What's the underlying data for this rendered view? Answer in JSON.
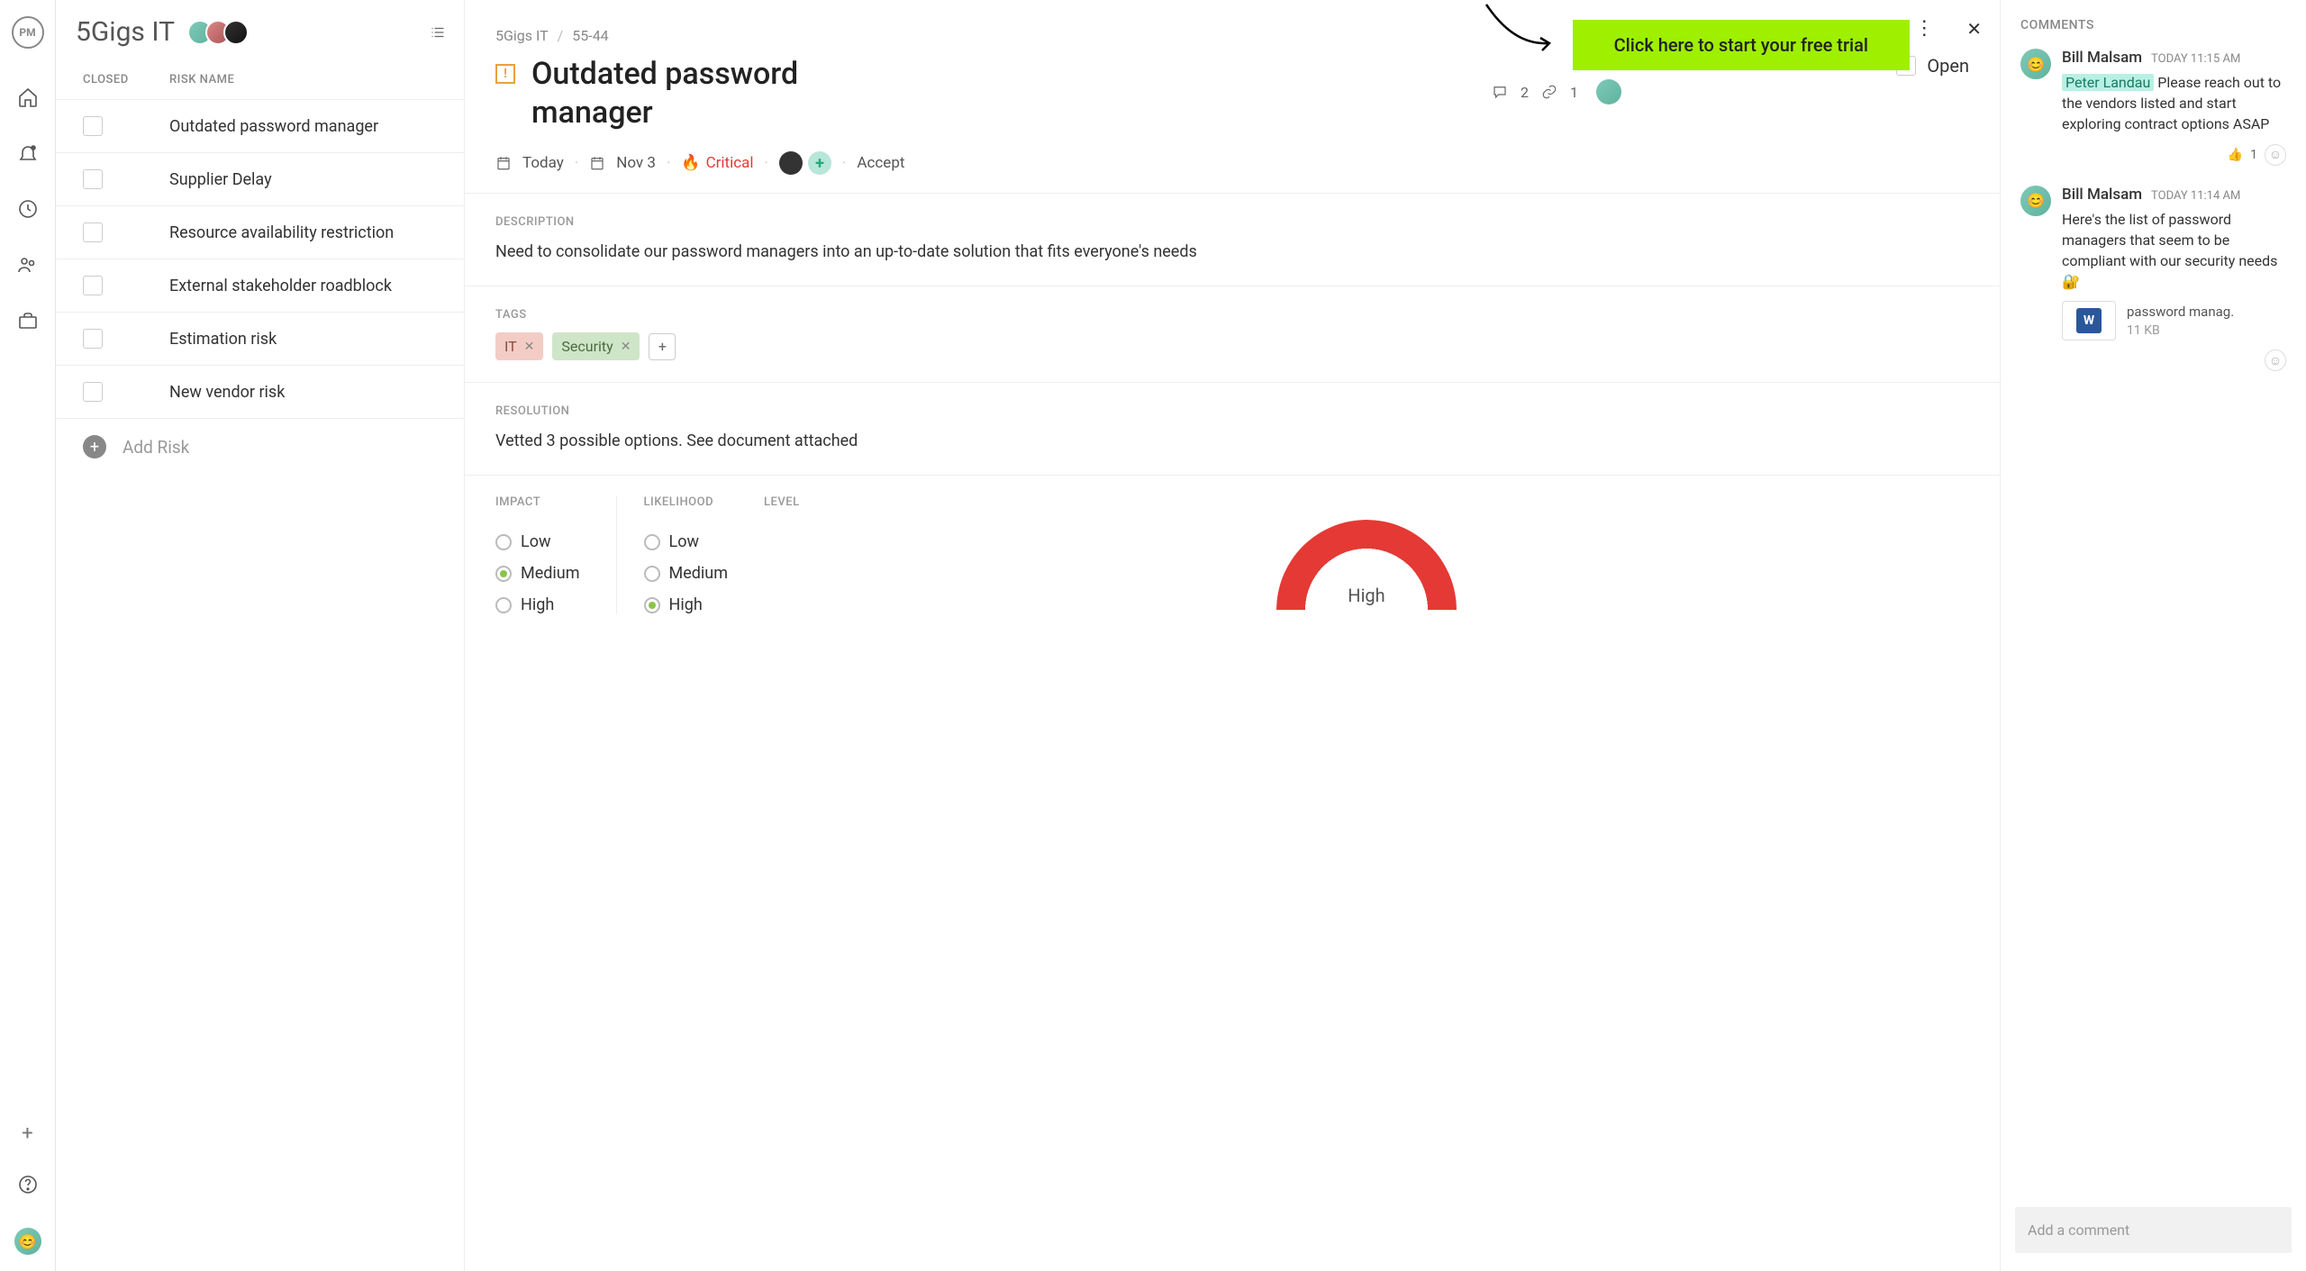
{
  "project": {
    "name": "5Gigs IT"
  },
  "trial_cta": "Click here to start your free trial",
  "list": {
    "headers": {
      "closed": "CLOSED",
      "name": "RISK NAME"
    },
    "risks": [
      {
        "name": "Outdated password manager"
      },
      {
        "name": "Supplier Delay"
      },
      {
        "name": "Resource availability restriction"
      },
      {
        "name": "External stakeholder roadblock"
      },
      {
        "name": "Estimation risk"
      },
      {
        "name": "New vendor risk"
      }
    ],
    "add_label": "Add Risk"
  },
  "detail": {
    "breadcrumb_project": "5Gigs IT",
    "breadcrumb_id": "55-44",
    "title": "Outdated password manager",
    "status": "Open",
    "comment_count": "2",
    "link_count": "1",
    "meta": {
      "created": "Today",
      "due": "Nov 3",
      "priority": "Critical",
      "response": "Accept"
    },
    "description_label": "DESCRIPTION",
    "description": "Need to consolidate our password managers into an up-to-date solution that fits everyone's needs",
    "tags_label": "TAGS",
    "tags": [
      {
        "label": "IT",
        "color": "it"
      },
      {
        "label": "Security",
        "color": "sec"
      }
    ],
    "resolution_label": "RESOLUTION",
    "resolution": "Vetted 3 possible options. See document attached",
    "impact_label": "IMPACT",
    "likelihood_label": "LIKELIHOOD",
    "level_label": "LEVEL",
    "options": {
      "low": "Low",
      "medium": "Medium",
      "high": "High"
    },
    "impact": "Medium",
    "likelihood": "High",
    "level": "High"
  },
  "comments": {
    "header": "COMMENTS",
    "items": [
      {
        "author": "Bill Malsam",
        "time": "TODAY 11:15 AM",
        "mention": "Peter Landau",
        "text": " Please reach out to the vendors listed and start exploring contract options ASAP",
        "like_count": "1"
      },
      {
        "author": "Bill Malsam",
        "time": "TODAY 11:14 AM",
        "text": "Here's the list of password managers that seem to be compliant with our security needs 🔐",
        "attachment": {
          "name": "password manag.",
          "size": "11 KB"
        }
      }
    ],
    "placeholder": "Add a comment"
  }
}
